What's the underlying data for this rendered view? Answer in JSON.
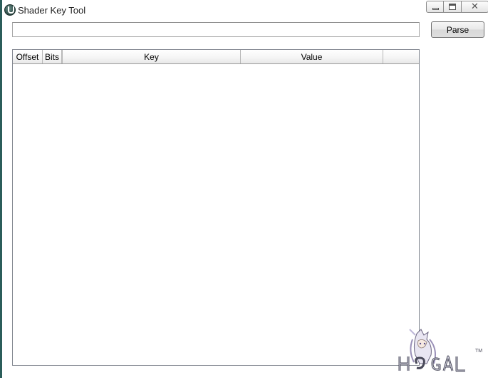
{
  "window": {
    "title": "Shader Key Tool",
    "accent_color": "#2b5d5a"
  },
  "caption_buttons": {
    "minimize_icon": "minimize-icon",
    "maximize_icon": "maximize-icon",
    "close_icon": "close-icon",
    "close_glyph": "✕"
  },
  "input": {
    "value": "",
    "placeholder": ""
  },
  "parse_button": {
    "label": "Parse"
  },
  "table": {
    "columns": [
      "Offset",
      "Bits",
      "Key",
      "Value",
      ""
    ],
    "rows": []
  },
  "watermark": {
    "text": "H♡GAL",
    "tm": "TM"
  }
}
